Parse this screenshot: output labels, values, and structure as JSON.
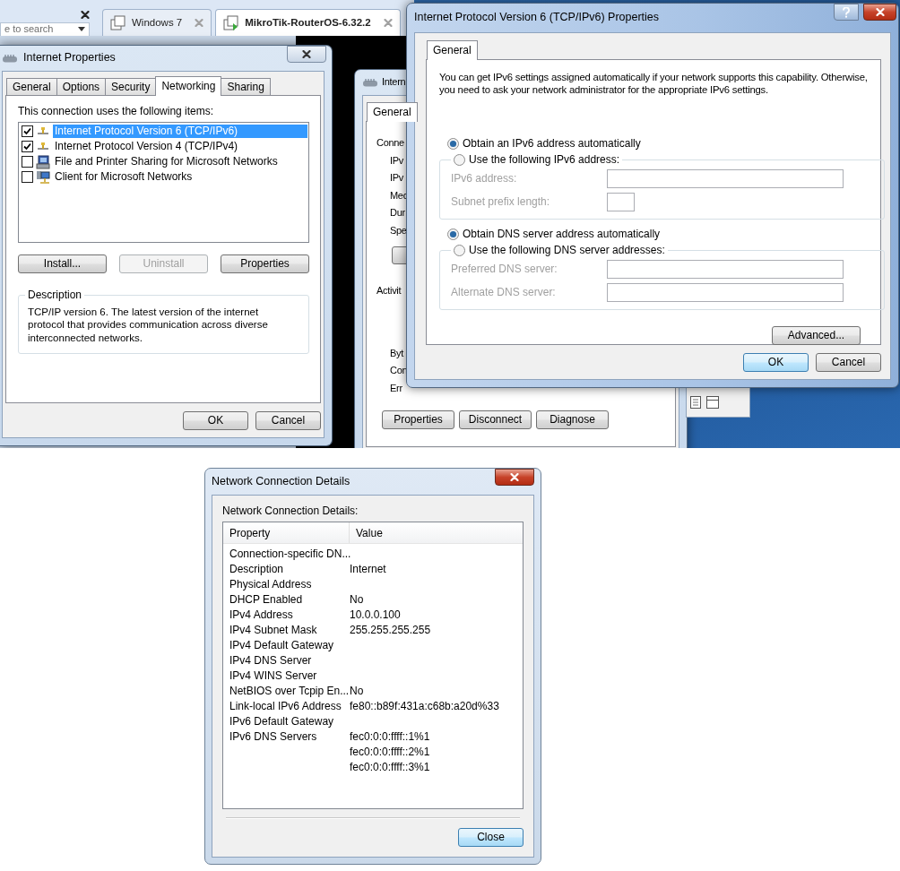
{
  "background_window": {
    "search_placeholder": "e to search",
    "tabs": [
      {
        "label": "Windows 7",
        "selected": false
      },
      {
        "label": "MikroTik-RouterOS-6.32.2",
        "selected": true
      }
    ]
  },
  "internet_properties": {
    "title": "Internet Properties",
    "tabs": [
      {
        "label": "General",
        "selected": false
      },
      {
        "label": "Options",
        "selected": false
      },
      {
        "label": "Security",
        "selected": false
      },
      {
        "label": "Networking",
        "selected": true
      },
      {
        "label": "Sharing",
        "selected": false
      }
    ],
    "items_label": "This connection uses the following items:",
    "items": [
      {
        "label": "Internet Protocol Version 6 (TCP/IPv6)",
        "kind": "protocol",
        "checked": true,
        "selected": true
      },
      {
        "label": "Internet Protocol Version 4 (TCP/IPv4)",
        "kind": "protocol",
        "checked": true,
        "selected": false
      },
      {
        "label": "File and Printer Sharing for Microsoft Networks",
        "kind": "service",
        "checked": false,
        "selected": false
      },
      {
        "label": "Client for Microsoft Networks",
        "kind": "client",
        "checked": false,
        "selected": false
      }
    ],
    "buttons": [
      {
        "label": "Install...",
        "disabled": false
      },
      {
        "label": "Uninstall",
        "disabled": true
      },
      {
        "label": "Properties",
        "disabled": false
      }
    ],
    "description_title": "Description",
    "description": "TCP/IP version 6. The latest version of the internet protocol that provides communication across diverse interconnected networks.",
    "footer_buttons": [
      "OK",
      "Cancel"
    ]
  },
  "status_window": {
    "title": "Intern",
    "tab": "General",
    "sections": [
      {
        "heading": "Conne",
        "rows": [
          "IPv",
          "IPv",
          "Med",
          "Dur",
          "Spe"
        ]
      },
      {
        "heading": "Activit",
        "rows": [
          "Byt",
          "Con",
          "Err"
        ]
      }
    ],
    "buttons": [
      "Properties",
      "Disconnect",
      "Diagnose"
    ]
  },
  "ipv6_dialog": {
    "title": "Internet Protocol Version 6 (TCP/IPv6) Properties",
    "tab": "General",
    "intro": "You can get IPv6 settings assigned automatically if your network supports this capability. Otherwise, you need to ask your network administrator for the appropriate IPv6 settings.",
    "groups": [
      {
        "auto_label": "Obtain an IPv6 address automatically",
        "manual_label": "Use the following IPv6 address:",
        "auto_selected": true,
        "fields": [
          {
            "label": "IPv6 address:",
            "kind": "wide"
          },
          {
            "label": "Subnet prefix length:",
            "kind": "short"
          }
        ]
      },
      {
        "auto_label": "Obtain DNS server address automatically",
        "manual_label": "Use the following DNS server addresses:",
        "auto_selected": true,
        "fields": [
          {
            "label": "Preferred DNS server:",
            "kind": "wide"
          },
          {
            "label": "Alternate DNS server:",
            "kind": "wide"
          }
        ]
      }
    ],
    "advanced_button": "Advanced...",
    "footer_buttons": [
      "OK",
      "Cancel"
    ]
  },
  "details_dialog": {
    "title": "Network Connection Details",
    "label": "Network Connection Details:",
    "columns": [
      "Property",
      "Value"
    ],
    "rows": [
      {
        "property": "Connection-specific DN..."
      },
      {
        "property": "Description",
        "values": [
          "Internet"
        ]
      },
      {
        "property": "Physical Address"
      },
      {
        "property": "DHCP Enabled",
        "values": [
          "No"
        ]
      },
      {
        "property": "IPv4 Address",
        "values": [
          "10.0.0.100"
        ]
      },
      {
        "property": "IPv4 Subnet Mask",
        "values": [
          "255.255.255.255"
        ]
      },
      {
        "property": "IPv4 Default Gateway"
      },
      {
        "property": "IPv4 DNS Server"
      },
      {
        "property": "IPv4 WINS Server"
      },
      {
        "property": "NetBIOS over Tcpip En...",
        "values": [
          "No"
        ]
      },
      {
        "property": "Link-local IPv6 Address",
        "values": [
          "fe80::b89f:431a:c68b:a20d%33"
        ]
      },
      {
        "property": "IPv6 Default Gateway"
      },
      {
        "property": "IPv6 DNS Servers",
        "values": [
          "fec0:0:0:ffff::1%1",
          "fec0:0:0:ffff::2%1",
          "fec0:0:0:ffff::3%1"
        ]
      }
    ],
    "close_button": "Close"
  }
}
